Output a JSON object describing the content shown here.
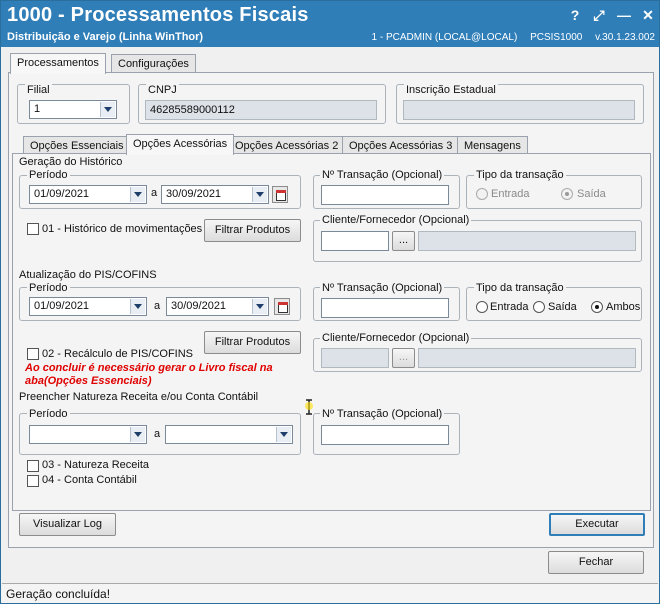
{
  "window": {
    "title": "1000 - Processamentos Fiscais",
    "subtitle": "Distribuição e Varejo (Linha WinThor)",
    "sysinfo": [
      "1 - PCADMIN (LOCAL@LOCAL)",
      "PCSIS1000",
      "v.30.1.23.002"
    ],
    "btn_help": "?",
    "btn_restore": "⤢",
    "btn_min": "—",
    "btn_close": "✕"
  },
  "top_tabs": [
    "Processamentos",
    "Configurações"
  ],
  "header": {
    "filial_label": "Filial",
    "filial_value": "1",
    "cnpj_label": "CNPJ",
    "cnpj_value": "46285589000112",
    "ie_label": "Inscrição Estadual",
    "ie_value": ""
  },
  "sub_tabs": [
    "Opções Essenciais",
    "Opções Acessórias",
    "Opções Acessórias 2",
    "Opções Acessórias 3",
    "Mensagens"
  ],
  "historico": {
    "section": "Geração do Histórico",
    "periodo_label": "Período",
    "date_from": "01/09/2021",
    "a": "a",
    "date_to": "30/09/2021",
    "transacao_label": "Nº Transação (Opcional)",
    "transacao_value": "",
    "tipo_label": "Tipo da transação",
    "entrada": "Entrada",
    "saida": "Saída",
    "checkbox_label": "01 - Histórico de movimentações",
    "filtrar": "Filtrar Produtos",
    "cliente_label": "Cliente/Fornecedor (Opcional)",
    "cliente_code": "",
    "ellipsis": "...",
    "cliente_name": ""
  },
  "piscofins": {
    "section": "Atualização do PIS/COFINS",
    "periodo_label": "Período",
    "date_from": "01/09/2021",
    "a": "a",
    "date_to": "30/09/2021",
    "transacao_label": "Nº Transação (Opcional)",
    "transacao_value": "",
    "tipo_label": "Tipo da transação",
    "entrada": "Entrada",
    "saida": "Saída",
    "ambos": "Ambos",
    "filtrar": "Filtrar Produtos",
    "checkbox_label": "02 - Recálculo de PIS/COFINS",
    "warning": "Ao concluir é necessário gerar o Livro fiscal na aba(Opções Essenciais)",
    "cliente_label": "Cliente/Fornecedor (Opcional)",
    "cliente_code": "",
    "ellipsis": "...",
    "cliente_name": ""
  },
  "natureza": {
    "section": "Preencher Natureza Receita e/ou Conta Contábil",
    "periodo_label": "Período",
    "date_from": "",
    "a": "a",
    "date_to": "",
    "transacao_label": "Nº Transação (Opcional)",
    "transacao_value": "",
    "chk3": "03 - Natureza Receita",
    "chk4": "04 - Conta Contábil"
  },
  "buttons": {
    "visualizar_log": "Visualizar Log",
    "executar": "Executar",
    "fechar": "Fechar"
  },
  "status": "Geração concluída!"
}
